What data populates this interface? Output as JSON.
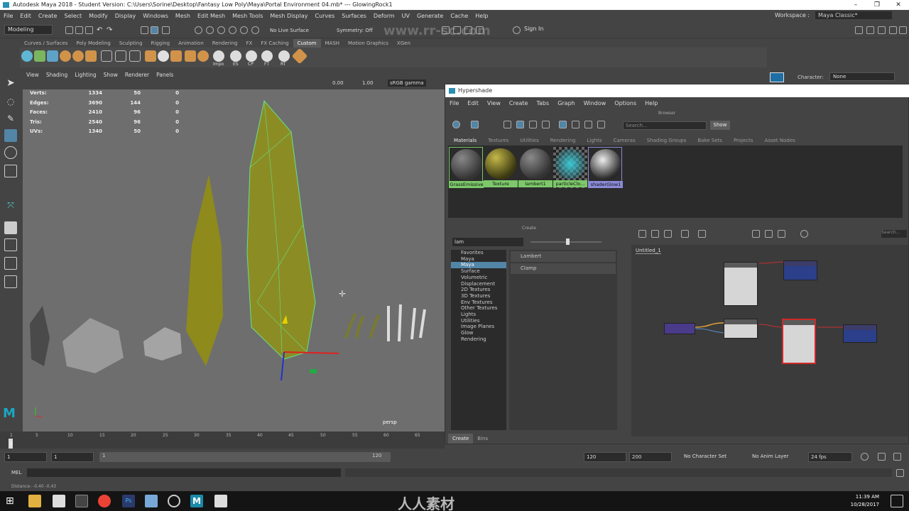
{
  "window": {
    "title": "Autodesk Maya 2018 - Student Version: C:\\Users\\Sorine\\Desktop\\Fantasy Low Poly\\Maya\\Portal Environment 04.mb*  ---  GlowingRock1",
    "minimize": "–",
    "restore": "❐",
    "close": "✕"
  },
  "menubar": {
    "items": [
      "File",
      "Edit",
      "Create",
      "Select",
      "Modify",
      "Display",
      "Windows",
      "Mesh",
      "Edit Mesh",
      "Mesh Tools",
      "Mesh Display",
      "Curves",
      "Surfaces",
      "Deform",
      "UV",
      "Generate",
      "Cache",
      "Help"
    ],
    "workspace_label": "Workspace :",
    "workspace_value": "Maya Classic*"
  },
  "statusline": {
    "mode": "Modeling",
    "live_surface": "No Live Surface",
    "symmetry": "Symmetry: Off",
    "sign_in": "Sign In",
    "watermark_url": "www.rr-sc.com"
  },
  "shelf": {
    "tabs": [
      "Curves / Surfaces",
      "Poly Modeling",
      "Sculpting",
      "Rigging",
      "Animation",
      "Rendering",
      "FX",
      "FX Caching",
      "Custom",
      "MASH",
      "Motion Graphics",
      "XGen"
    ],
    "active_tab": "Custom",
    "icon_labels": [
      "Impo",
      "ES",
      "CP",
      "FT",
      "RT"
    ],
    "character_label": "Character:",
    "character_value": "None"
  },
  "viewport": {
    "menu": [
      "View",
      "Shading",
      "Lighting",
      "Show",
      "Renderer",
      "Panels"
    ],
    "exposure": "0.00",
    "gamma": "1.00",
    "color_space": "sRGB gamma",
    "hud": [
      {
        "label": "Verts:",
        "v1": "1334",
        "v2": "50",
        "v3": "0"
      },
      {
        "label": "Edges:",
        "v1": "3690",
        "v2": "144",
        "v3": "0"
      },
      {
        "label": "Faces:",
        "v1": "2410",
        "v2": "96",
        "v3": "0"
      },
      {
        "label": "Tris:",
        "v1": "2540",
        "v2": "96",
        "v3": "0"
      },
      {
        "label": "UVs:",
        "v1": "1340",
        "v2": "50",
        "v3": "0"
      }
    ],
    "camera_label": "persp"
  },
  "hypershade": {
    "title": "Hypershade",
    "menu": [
      "File",
      "Edit",
      "View",
      "Create",
      "Tabs",
      "Graph",
      "Window",
      "Options",
      "Help"
    ],
    "browser_label": "Browser",
    "search_placeholder": "Search...",
    "show_button": "Show",
    "tabs": [
      "Materials",
      "Textures",
      "Utilities",
      "Rendering",
      "Lights",
      "Cameras",
      "Shading Groups",
      "Bake Sets",
      "Projects",
      "Asset Nodes"
    ],
    "active_tab": "Materials",
    "materials": [
      {
        "name": "GrassEmissive",
        "color": "#7cc86a"
      },
      {
        "name": "Texture",
        "color": "#7cc86a"
      },
      {
        "name": "lambert1",
        "color": "#7cc86a"
      },
      {
        "name": "particleClo...",
        "color": "#7cc86a"
      },
      {
        "name": "shaderGlow1",
        "color": "#8a8ad8"
      }
    ],
    "create_label": "Create",
    "create_search": "lam",
    "create_tree": [
      "Favorites",
      "Maya",
      "Maya",
      "Surface",
      "Volumetric",
      "Displacement",
      "2D Textures",
      "3D Textures",
      "Env Textures",
      "Other Textures",
      "Lights",
      "Utilities",
      "Image Planes",
      "Glow",
      "Rendering"
    ],
    "create_results": [
      "Lambert",
      "Clamp"
    ],
    "bottom_tabs": [
      "Create",
      "Bins"
    ],
    "graph_tab": "Untitled_1",
    "graph_search_placeholder": "Search..."
  },
  "timeline": {
    "ticks": [
      "1",
      "5",
      "10",
      "15",
      "20",
      "25",
      "30",
      "35",
      "40",
      "45",
      "50",
      "55",
      "60",
      "65"
    ],
    "current_frame": "1"
  },
  "range": {
    "start": "1",
    "inner_start": "1",
    "slider_start": "1",
    "slider_end": "120",
    "end": "120",
    "out_end": "200",
    "character_set": "No Character Set",
    "anim_layer": "No Anim Layer",
    "fps": "24 fps"
  },
  "cmdline": {
    "label": "MEL"
  },
  "helpline": {
    "text": "Distance:  -0.40    -0.43"
  },
  "taskbar": {
    "time": "11:39 AM",
    "date": "10/28/2017",
    "watermark": "人人素材"
  }
}
